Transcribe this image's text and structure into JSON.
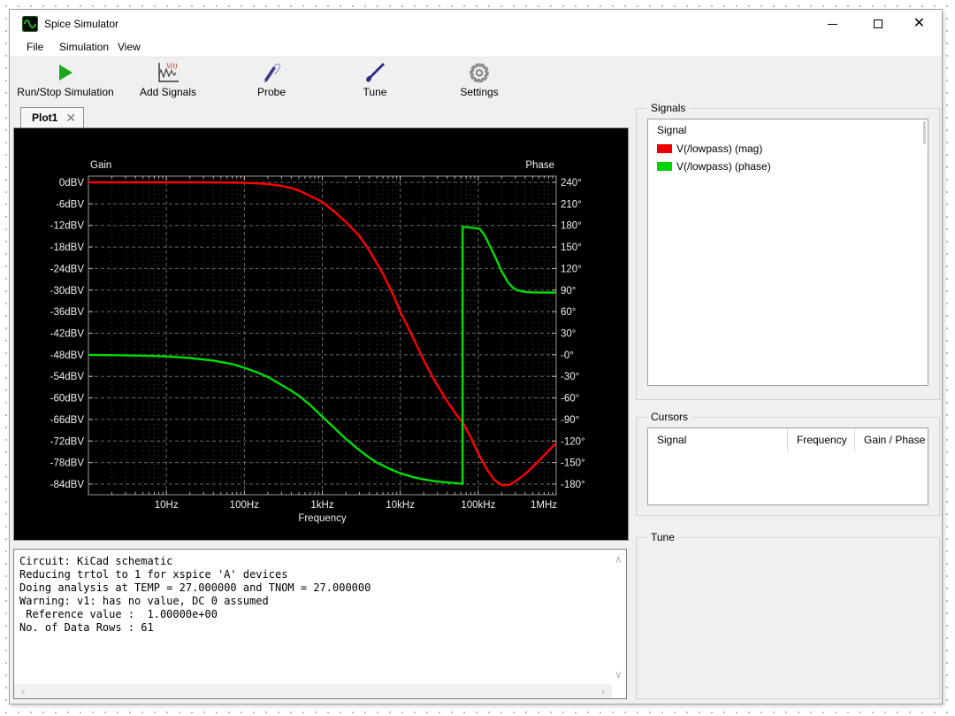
{
  "window": {
    "title": "Spice Simulator"
  },
  "menu": {
    "items": [
      "File",
      "Simulation",
      "View"
    ]
  },
  "toolbar": {
    "buttons": [
      {
        "label": "Run/Stop Simulation",
        "icon": "play-icon"
      },
      {
        "label": "Add Signals",
        "icon": "add-signals-icon"
      },
      {
        "label": "Probe",
        "icon": "probe-icon"
      },
      {
        "label": "Tune",
        "icon": "tune-icon"
      },
      {
        "label": "Settings",
        "icon": "gear-icon"
      }
    ]
  },
  "tabs": [
    {
      "label": "Plot1",
      "active": true
    }
  ],
  "chart_data": {
    "type": "line",
    "x_axis": {
      "label": "Frequency",
      "scale": "log",
      "min": 1,
      "max": 1000000,
      "tick_values": [
        10,
        100,
        1000,
        10000,
        100000,
        1000000
      ],
      "tick_labels": [
        "10Hz",
        "100Hz",
        "1kHz",
        "10kHz",
        "100kHz",
        "1MHz"
      ]
    },
    "y_axis_left": {
      "label": "Gain",
      "unit": "dBV",
      "max": 0,
      "min": -84,
      "step": 6,
      "tick_labels": [
        "0dBV",
        "-6dBV",
        "-12dBV",
        "-18dBV",
        "-24dBV",
        "-30dBV",
        "-36dBV",
        "-42dBV",
        "-48dBV",
        "-54dBV",
        "-60dBV",
        "-66dBV",
        "-72dBV",
        "-78dBV",
        "-84dBV"
      ]
    },
    "y_axis_right": {
      "label": "Phase",
      "unit": "deg",
      "max": 240,
      "min": -180,
      "step": 30,
      "tick_labels": [
        "240°",
        "210°",
        "180°",
        "150°",
        "120°",
        "90°",
        "60°",
        "30°",
        "-0°",
        "-30°",
        "-60°",
        "-90°",
        "-120°",
        "-150°",
        "-180°"
      ]
    },
    "grid": "dashed",
    "background": "#000000",
    "series": [
      {
        "name": "V(/lowpass) (mag)",
        "axis": "left",
        "color": "#ff0000",
        "points": [
          [
            1,
            0
          ],
          [
            5,
            0
          ],
          [
            10,
            0
          ],
          [
            30,
            -0.02
          ],
          [
            60,
            -0.07
          ],
          [
            100,
            -0.16
          ],
          [
            150,
            -0.3
          ],
          [
            200,
            -0.5
          ],
          [
            300,
            -1
          ],
          [
            400,
            -1.6
          ],
          [
            500,
            -2.3
          ],
          [
            700,
            -3.8
          ],
          [
            1000,
            -5.5
          ],
          [
            1400,
            -8
          ],
          [
            2000,
            -11
          ],
          [
            3000,
            -15
          ],
          [
            4000,
            -19
          ],
          [
            6000,
            -25.5
          ],
          [
            8000,
            -31
          ],
          [
            10000,
            -36
          ],
          [
            14000,
            -42.5
          ],
          [
            20000,
            -49.5
          ],
          [
            28000,
            -55.5
          ],
          [
            40000,
            -61
          ],
          [
            56000,
            -65.5
          ],
          [
            64000,
            -67
          ],
          [
            80000,
            -71
          ],
          [
            100000,
            -75.5
          ],
          [
            130000,
            -80
          ],
          [
            160000,
            -82.8
          ],
          [
            200000,
            -84.3
          ],
          [
            250000,
            -84.2
          ],
          [
            300000,
            -83.2
          ],
          [
            400000,
            -81.2
          ],
          [
            500000,
            -79.2
          ],
          [
            700000,
            -76
          ],
          [
            1000000,
            -72.5
          ]
        ]
      },
      {
        "name": "V(/lowpass) (phase)",
        "axis": "right",
        "color": "#00dc00",
        "points": [
          [
            1,
            -0.2
          ],
          [
            2,
            -0.5
          ],
          [
            4,
            -1
          ],
          [
            7,
            -1.7
          ],
          [
            10,
            -2.3
          ],
          [
            20,
            -4.5
          ],
          [
            40,
            -8
          ],
          [
            70,
            -13
          ],
          [
            100,
            -18
          ],
          [
            150,
            -25
          ],
          [
            200,
            -31
          ],
          [
            300,
            -42
          ],
          [
            400,
            -50
          ],
          [
            500,
            -57
          ],
          [
            700,
            -70
          ],
          [
            1000,
            -86
          ],
          [
            1400,
            -101
          ],
          [
            2000,
            -117
          ],
          [
            3000,
            -133
          ],
          [
            4000,
            -143
          ],
          [
            5000,
            -150
          ],
          [
            7000,
            -158
          ],
          [
            10000,
            -165
          ],
          [
            15000,
            -170.5
          ],
          [
            20000,
            -173.5
          ],
          [
            30000,
            -176.5
          ],
          [
            45000,
            -178
          ],
          [
            60000,
            -179.5
          ],
          [
            63000,
            -180
          ],
          [
            63000,
            178
          ],
          [
            70000,
            177.5
          ],
          [
            90000,
            176.5
          ],
          [
            105000,
            175
          ],
          [
            120000,
            167
          ],
          [
            140000,
            152
          ],
          [
            170000,
            133
          ],
          [
            200000,
            116
          ],
          [
            240000,
            101
          ],
          [
            280000,
            93
          ],
          [
            320000,
            89.5
          ],
          [
            400000,
            87.5
          ],
          [
            500000,
            86.8
          ],
          [
            700000,
            86.5
          ],
          [
            1000000,
            86.5
          ]
        ]
      }
    ]
  },
  "signals_panel": {
    "title": "Signals",
    "list_header": "Signal",
    "items": [
      {
        "label": "V(/lowpass) (mag)",
        "color": "#ee0000"
      },
      {
        "label": "V(/lowpass) (phase)",
        "color": "#00d400"
      }
    ]
  },
  "cursors_panel": {
    "title": "Cursors",
    "columns": [
      "Signal",
      "Frequency",
      "Gain / Phase"
    ],
    "rows": []
  },
  "tune_panel": {
    "title": "Tune"
  },
  "console": {
    "lines": [
      "Circuit: KiCad schematic",
      "Reducing trtol to 1 for xspice 'A' devices",
      "Doing analysis at TEMP = 27.000000 and TNOM = 27.000000",
      "Warning: v1: has no value, DC 0 assumed",
      " Reference value :  1.00000e+00",
      "No. of Data Rows : 61"
    ]
  }
}
